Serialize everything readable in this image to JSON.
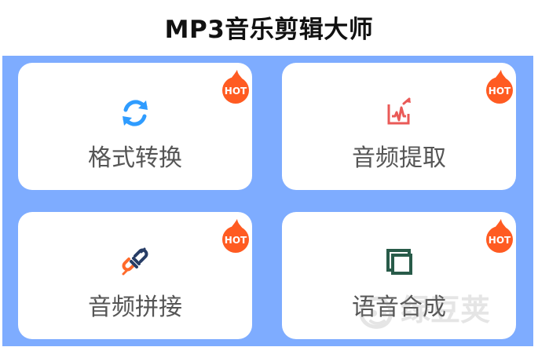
{
  "header": {
    "title": "MP3音乐剪辑大师"
  },
  "features": [
    {
      "label": "格式转换",
      "icon": "refresh-icon",
      "badge": "HOT"
    },
    {
      "label": "音频提取",
      "icon": "audio-extract-icon",
      "badge": "HOT"
    },
    {
      "label": "音频拼接",
      "icon": "audio-join-icon",
      "badge": "HOT"
    },
    {
      "label": "语音合成",
      "icon": "voice-synthesis-icon",
      "badge": "HOT"
    }
  ],
  "watermark": {
    "text": "绿豆荚"
  },
  "colors": {
    "background": "#7eacff",
    "card": "#ffffff",
    "hot": "#ff5b22",
    "convert": "#2f9cff",
    "extract": "#ea5a57",
    "join_blue": "#273d66",
    "join_orange": "#ff6a2b",
    "synthesis": "#285b49"
  }
}
